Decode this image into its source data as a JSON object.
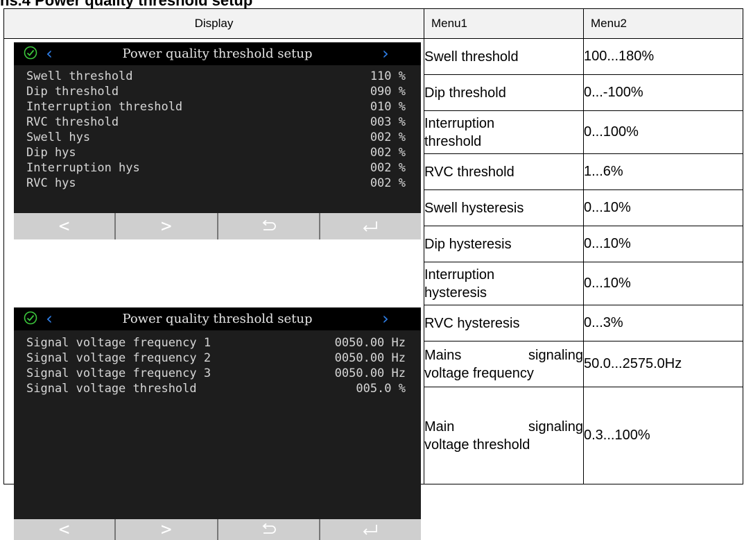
{
  "heading": "ns.4 Power quality threshold setup",
  "table": {
    "headers": {
      "display": "Display",
      "menu1": "Menu1",
      "menu2": "Menu2"
    },
    "rows": [
      {
        "menu1": [
          "Swell threshold"
        ],
        "menu2": "100...180%"
      },
      {
        "menu1": [
          "Dip threshold"
        ],
        "menu2": "0...-100%"
      },
      {
        "menu1": [
          "Interruption",
          "threshold"
        ],
        "menu2": "0...100%"
      },
      {
        "menu1": [
          "RVC threshold"
        ],
        "menu2": "1...6%"
      },
      {
        "menu1": [
          "Swell hysteresis"
        ],
        "menu2": "0...10%"
      },
      {
        "menu1": [
          "Dip hysteresis"
        ],
        "menu2": "0...10%"
      },
      {
        "menu1": [
          "Interruption",
          "hysteresis"
        ],
        "menu2": "0...10%"
      },
      {
        "menu1": [
          "RVC hysteresis"
        ],
        "menu2": "0...3%"
      },
      {
        "menu1": [
          "Mains signaling",
          "voltage frequency"
        ],
        "menu2": "50.0...2575.0Hz"
      },
      {
        "menu1": [
          "Main signaling",
          "voltage threshold"
        ],
        "menu2": "0.3...100%"
      }
    ]
  },
  "screens": [
    {
      "title": "Power quality threshold setup",
      "params": [
        {
          "label": "Swell threshold",
          "value": "110 %"
        },
        {
          "label": "Dip threshold",
          "value": "090 %"
        },
        {
          "label": "Interruption threshold",
          "value": "010 %"
        },
        {
          "label": "RVC threshold",
          "value": "003 %"
        },
        {
          "label": "Swell hys",
          "value": "002 %"
        },
        {
          "label": "Dip hys",
          "value": "002 %"
        },
        {
          "label": "Interruption hys",
          "value": "002 %"
        },
        {
          "label": "RVC hys",
          "value": "002 %"
        }
      ]
    },
    {
      "title": "Power quality threshold setup",
      "params": [
        {
          "label": "Signal voltage frequency 1",
          "value": "0050.00 Hz"
        },
        {
          "label": "Signal voltage frequency 2",
          "value": "0050.00 Hz"
        },
        {
          "label": "Signal voltage frequency 3",
          "value": "0050.00 Hz"
        },
        {
          "label": "Signal voltage threshold",
          "value": "005.0 %"
        }
      ]
    }
  ],
  "softkeys": {
    "left": "<",
    "right": ">"
  },
  "icons": {
    "status": "check-circle-icon",
    "nav_prev": "chevron-left-icon",
    "nav_next": "chevron-right-icon",
    "keys": [
      "chevron-left-icon",
      "chevron-right-icon",
      "return-icon",
      "enter-icon"
    ]
  },
  "colors": {
    "screen_bg": "#1d1d1d",
    "title_bg": "#000000",
    "accent_blue": "#2f7fe8",
    "check_green": "#3cc83c",
    "softkey_bg": "#cfcfcf"
  }
}
